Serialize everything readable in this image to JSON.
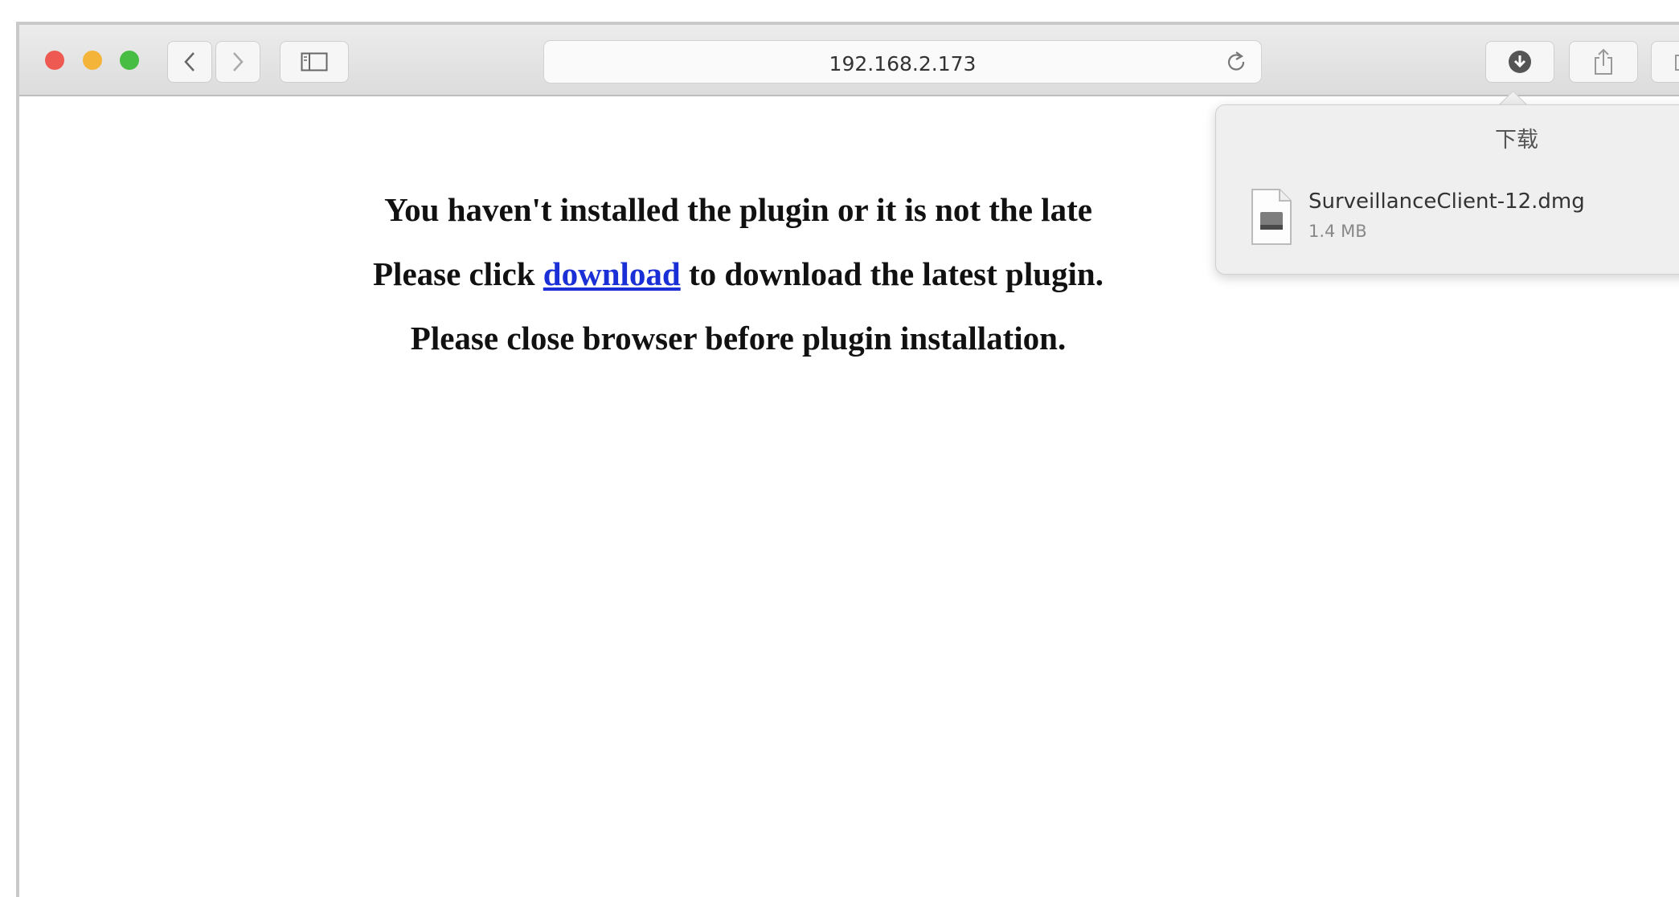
{
  "browser": {
    "address": "192.168.2.173"
  },
  "page": {
    "line1": "You haven't installed the plugin or it is not the late",
    "line2_before": "Please click ",
    "line2_link": "download",
    "line2_after": " to download the latest plugin.",
    "line3": "Please close browser before plugin installation."
  },
  "downloads": {
    "title": "下载",
    "items": [
      {
        "filename": "SurveillanceClient-12.dmg",
        "size": "1.4 MB",
        "icon": "dmg-file-icon"
      }
    ]
  },
  "icons": [
    "back-arrow-icon",
    "forward-arrow-icon",
    "sidebar-icon",
    "reload-icon",
    "download-icon",
    "share-icon"
  ]
}
